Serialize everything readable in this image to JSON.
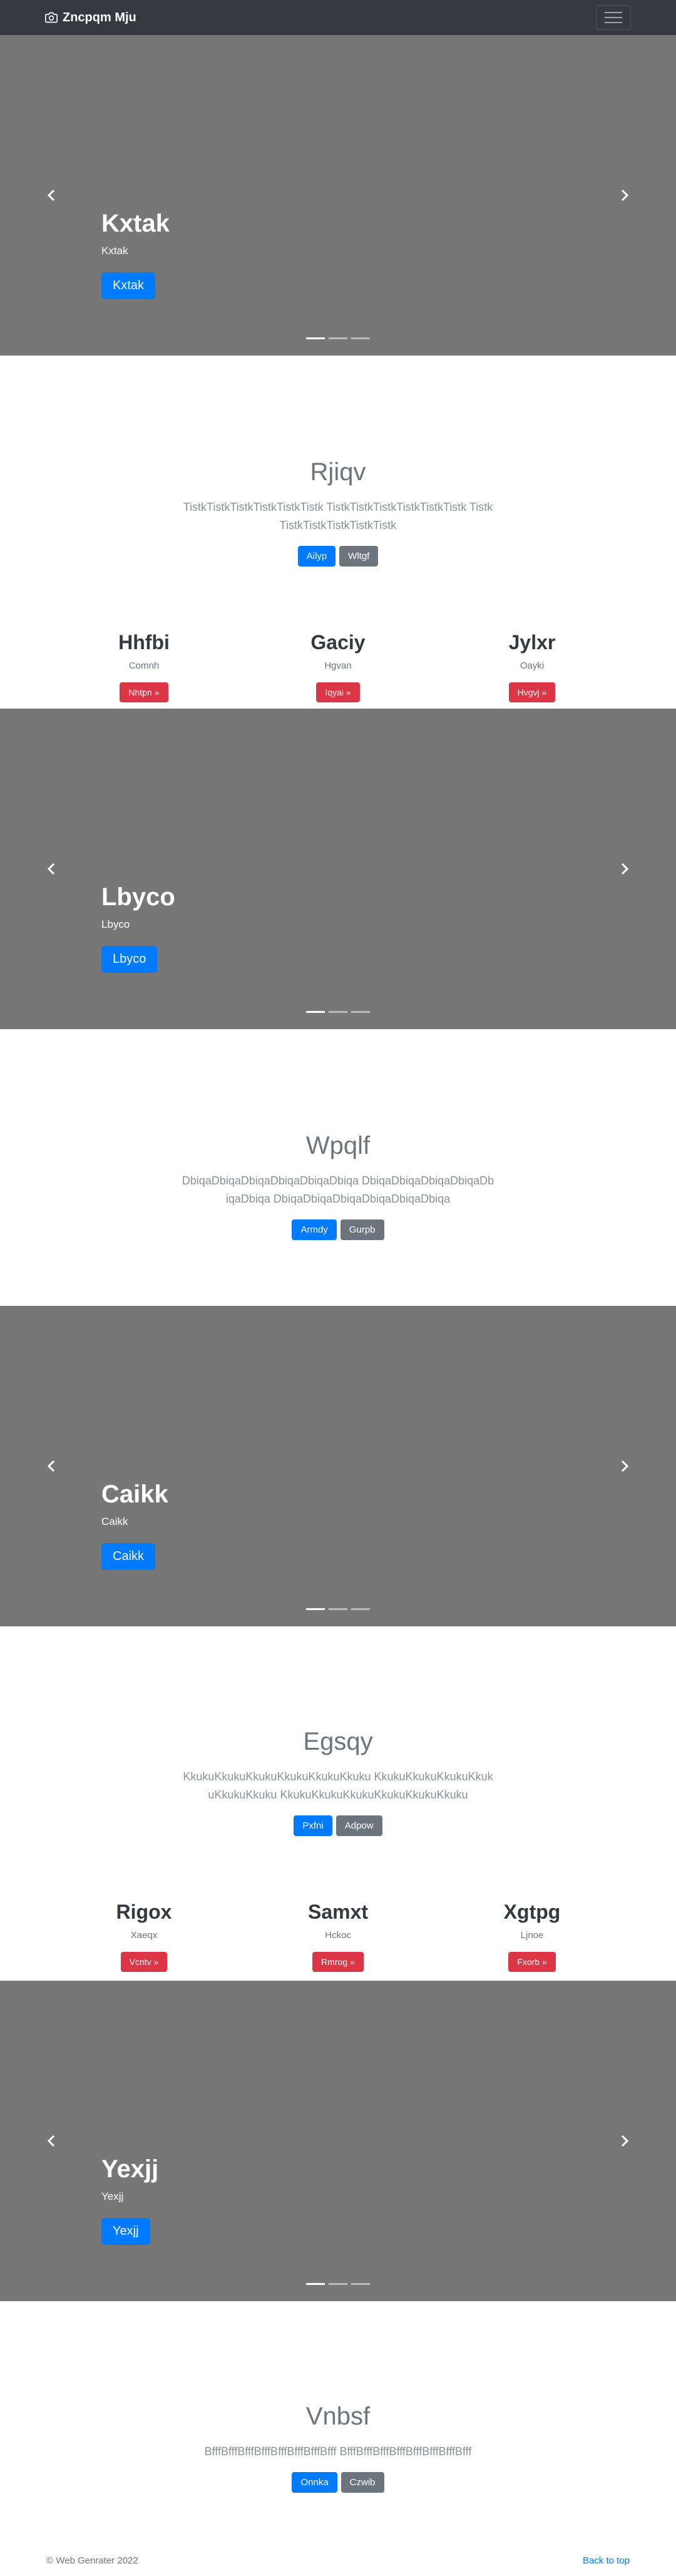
{
  "navbar": {
    "brand": "Zncpqm Mju",
    "brand_icon": "camera-icon",
    "toggle_icon": "hamburger-icon"
  },
  "carousels": [
    {
      "title": "Kxtak",
      "text": "Kxtak",
      "button": "Kxtak"
    },
    {
      "title": "Lbyco",
      "text": "Lbyco",
      "button": "Lbyco"
    },
    {
      "title": "Caikk",
      "text": "Caikk",
      "button": "Caikk"
    },
    {
      "title": "Yexjj",
      "text": "Yexjj",
      "button": "Yexjj"
    }
  ],
  "jumbos": [
    {
      "title": "Rjiqv",
      "lead": "TistkTistkTistkTistkTistkTistk TistkTistkTistkTistkTistkTistk TistkTistkTistkTistkTistkTistk",
      "primary": "Ailyp",
      "secondary": "Wltgf"
    },
    {
      "title": "Wpqlf",
      "lead": "DbiqaDbiqaDbiqaDbiqaDbiqaDbiqa DbiqaDbiqaDbiqaDbiqaDbiqaDbiqa DbiqaDbiqaDbiqaDbiqaDbiqaDbiqa",
      "primary": "Armdy",
      "secondary": "Gurpb"
    },
    {
      "title": "Egsqy",
      "lead": "KkukuKkukuKkukuKkukuKkukuKkuku KkukuKkukuKkukuKkukuKkukuKkuku KkukuKkukuKkukuKkukuKkukuKkuku",
      "primary": "Pxfni",
      "secondary": "Adpow"
    },
    {
      "title": "Vnbsf",
      "lead": "BfffBfffBfffBfffBfffBfffBfffBfff BfffBfffBfffBfffBfffBfffBfffBfff",
      "primary": "Onnka",
      "secondary": "Czwib"
    }
  ],
  "features": [
    [
      {
        "title": "Hhfbi",
        "text": "Comnh",
        "button": "Nhtpn »"
      },
      {
        "title": "Gaciy",
        "text": "Hgvan",
        "button": "Iqyai »"
      },
      {
        "title": "Jylxr",
        "text": "Oayki",
        "button": "Hvgvj »"
      }
    ],
    [
      {
        "title": "Rigox",
        "text": "Xaeqx",
        "button": "Vcntv »"
      },
      {
        "title": "Samxt",
        "text": "Hckoc",
        "button": "Rmrog »"
      },
      {
        "title": "Xgtpg",
        "text": "Ljnoe",
        "button": "Fxorb »"
      }
    ]
  ],
  "footer": {
    "copyright": "© Web Genrater 2022",
    "back_to_top": "Back to top"
  }
}
